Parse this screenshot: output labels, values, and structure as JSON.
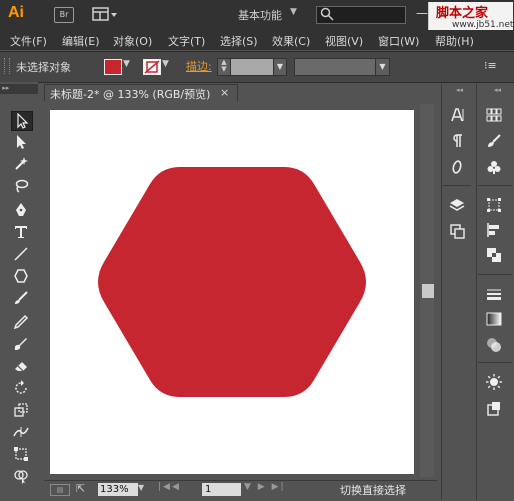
{
  "app": {
    "logo": "Ai",
    "bridge_label": "Br",
    "workspace": "基本功能",
    "minimize": "—"
  },
  "watermark": {
    "title": "脚本之家",
    "url": "www.jb51.net"
  },
  "menu": [
    "文件(F)",
    "编辑(E)",
    "对象(O)",
    "文字(T)",
    "选择(S)",
    "效果(C)",
    "视图(V)",
    "窗口(W)",
    "帮助(H)"
  ],
  "control": {
    "selection_status": "未选择对象",
    "fill_color": "#c6262f",
    "stroke_label": "描边:",
    "stroke_label_color": "#e89a2c"
  },
  "document": {
    "tab_label": "未标题-2* @ 133% (RGB/预览)",
    "close": "×",
    "shape_color": "#c6262f",
    "shape": "rounded-hexagon"
  },
  "status": {
    "zoom": "133%",
    "page": "1",
    "status_text": "切换直接选择"
  },
  "icons": {
    "tools": [
      "selection-tool-icon",
      "direct-selection-tool-icon",
      "magic-wand-icon",
      "lasso-icon",
      "pen-tool-icon",
      "type-tool-icon",
      "line-tool-icon",
      "polygon-tool-icon",
      "paintbrush-icon",
      "pencil-icon",
      "blob-brush-icon",
      "eraser-icon",
      "rotate-icon",
      "scale-icon",
      "width-tool-icon",
      "free-transform-icon",
      "shape-builder-icon"
    ],
    "dock1": [
      "character-icon",
      "paragraph-icon",
      "opentype-icon",
      "layers-icon",
      "artboards-icon"
    ],
    "dock2": [
      "swatches-icon",
      "brushes-icon",
      "symbols-icon",
      "transform-icon",
      "align-icon",
      "pathfinder-icon",
      "stroke-icon",
      "gradient-icon",
      "transparency-icon",
      "appearance-icon",
      "graphic-styles-icon"
    ]
  }
}
